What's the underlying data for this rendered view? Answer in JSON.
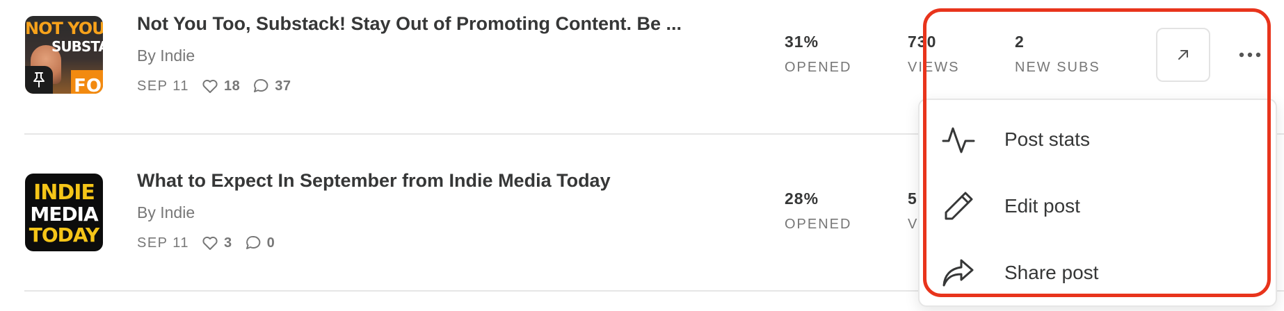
{
  "posts": [
    {
      "title": "Not You Too, Substack! Stay Out of Promoting Content. Be ...",
      "byline": "By Indie",
      "date": "SEP 11",
      "likes": "18",
      "comments": "37",
      "opened_value": "31%",
      "opened_label": "OPENED",
      "views_value": "730",
      "views_label": "VIEWS",
      "subs_value": "2",
      "subs_label": "NEW SUBS",
      "thumb_text": [
        "NOT YOU TO",
        "SUBSTAC",
        "FO"
      ],
      "pinned": true
    },
    {
      "title": "What to Expect In September from Indie Media Today",
      "byline": "By Indie",
      "date": "SEP 11",
      "likes": "3",
      "comments": "0",
      "opened_value": "28%",
      "opened_label": "OPENED",
      "views_value": "5",
      "views_label": "V",
      "thumb_text": [
        "INDIE",
        "MEDIA",
        "TODAY"
      ]
    }
  ],
  "menu": {
    "items": [
      {
        "label": "Post stats",
        "icon": "activity-icon"
      },
      {
        "label": "Edit post",
        "icon": "pencil-icon"
      },
      {
        "label": "Share post",
        "icon": "share-arrow-icon"
      }
    ]
  },
  "colors": {
    "text": "#363737",
    "muted": "#777777",
    "highlight": "#e8341c",
    "divider": "#e6e6e6"
  }
}
